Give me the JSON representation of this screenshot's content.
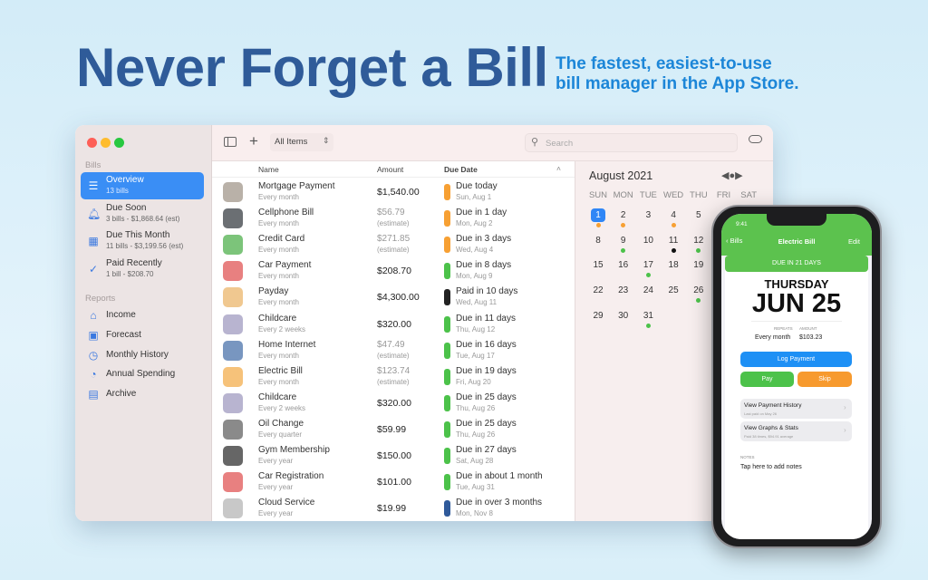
{
  "hero": {
    "headline": "Never Forget a Bill",
    "tagline_1": "The fastest, easiest-to-use",
    "tagline_2": "bill manager in the App Store."
  },
  "sidebar": {
    "bills_header": "Bills",
    "reports_header": "Reports",
    "items": [
      {
        "label": "Overview",
        "sub": "13 bills",
        "icon": "list-icon",
        "selected": true
      },
      {
        "label": "Due Soon",
        "sub": "3 bills - $1,868.64 (est)",
        "icon": "bell-icon"
      },
      {
        "label": "Due This Month",
        "sub": "11 bills - $3,199.56 (est)",
        "icon": "calendar-icon"
      },
      {
        "label": "Paid Recently",
        "sub": "1 bill - $208.70",
        "icon": "checkmark-icon"
      }
    ],
    "reports": [
      {
        "label": "Income",
        "icon": "bank-icon"
      },
      {
        "label": "Forecast",
        "icon": "chart-icon"
      },
      {
        "label": "Monthly History",
        "icon": "clock-icon"
      },
      {
        "label": "Annual Spending",
        "icon": "pie-icon"
      },
      {
        "label": "Archive",
        "icon": "archive-icon"
      }
    ]
  },
  "toolbar": {
    "filter": "All Items",
    "search_placeholder": "Search"
  },
  "table": {
    "columns": [
      "Name",
      "Amount",
      "Due Date"
    ],
    "rows": [
      {
        "name": "Mortgage Payment",
        "freq": "Every month",
        "amount": "$1,540.00",
        "due": "Due today",
        "date": "Sun, Aug 1",
        "status": "#f7a033",
        "icon": "house-icon",
        "icolor": "#b9b1a8"
      },
      {
        "name": "Cellphone Bill",
        "freq": "Every month",
        "amount": "$56.79",
        "estimate": "(estimate)",
        "due": "Due in 1 day",
        "date": "Mon, Aug 2",
        "status": "#f7a033",
        "icon": "phone-icon",
        "icolor": "#6b6f73"
      },
      {
        "name": "Credit Card",
        "freq": "Every month",
        "amount": "$271.85",
        "estimate": "(estimate)",
        "due": "Due in 3 days",
        "date": "Wed, Aug 4",
        "status": "#f7a033",
        "icon": "credit-card-icon",
        "icolor": "#7cc47a"
      },
      {
        "name": "Car Payment",
        "freq": "Every month",
        "amount": "$208.70",
        "due": "Due in 8 days",
        "date": "Mon, Aug 9",
        "status": "#4cc24a",
        "icon": "car-icon",
        "icolor": "#e88080"
      },
      {
        "name": "Payday",
        "freq": "Every month",
        "amount": "$4,300.00",
        "due": "Paid in 10 days",
        "date": "Wed, Aug 11",
        "status": "#222222",
        "icon": "coins-icon",
        "icolor": "#f0c890"
      },
      {
        "name": "Childcare",
        "freq": "Every 2 weeks",
        "amount": "$320.00",
        "due": "Due in 11 days",
        "date": "Thu, Aug 12",
        "status": "#4cc24a",
        "icon": "stroller-icon",
        "icolor": "#b8b4d0"
      },
      {
        "name": "Home Internet",
        "freq": "Every month",
        "amount": "$47.49",
        "estimate": "(estimate)",
        "due": "Due in 16 days",
        "date": "Tue, Aug 17",
        "status": "#4cc24a",
        "icon": "globe-icon",
        "icolor": "#7896c0"
      },
      {
        "name": "Electric Bill",
        "freq": "Every month",
        "amount": "$123.74",
        "estimate": "(estimate)",
        "due": "Due in 19 days",
        "date": "Fri, Aug 20",
        "status": "#4cc24a",
        "icon": "lightbulb-icon",
        "icolor": "#f6c27a"
      },
      {
        "name": "Childcare",
        "freq": "Every 2 weeks",
        "amount": "$320.00",
        "due": "Due in 25 days",
        "date": "Thu, Aug 26",
        "status": "#4cc24a",
        "icon": "stroller-icon",
        "icolor": "#b8b4d0"
      },
      {
        "name": "Oil Change",
        "freq": "Every quarter",
        "amount": "$59.99",
        "due": "Due in 25 days",
        "date": "Thu, Aug 26",
        "status": "#4cc24a",
        "icon": "wrench-icon",
        "icolor": "#8a8a8a"
      },
      {
        "name": "Gym Membership",
        "freq": "Every year",
        "amount": "$150.00",
        "due": "Due in 27 days",
        "date": "Sat, Aug 28",
        "status": "#4cc24a",
        "icon": "dumbbell-icon",
        "icolor": "#666666"
      },
      {
        "name": "Car Registration",
        "freq": "Every year",
        "amount": "$101.00",
        "due": "Due in about 1 month",
        "date": "Tue, Aug 31",
        "status": "#4cc24a",
        "icon": "car-icon",
        "icolor": "#e88080"
      },
      {
        "name": "Cloud Service",
        "freq": "Every year",
        "amount": "$19.99",
        "due": "Due in over 3 months",
        "date": "Mon, Nov 8",
        "status": "#2f5a9a",
        "icon": "cloud-icon",
        "icolor": "#c8c8c8"
      }
    ]
  },
  "calendar": {
    "title": "August 2021",
    "weekdays": [
      "SUN",
      "MON",
      "TUE",
      "WED",
      "THU",
      "FRI",
      "SAT"
    ],
    "first_weekday": 0,
    "days": 31,
    "today": 1,
    "dots": {
      "1": "#f7a033",
      "2": "#f7a033",
      "4": "#f7a033",
      "9": "#4cc24a",
      "11": "#111111",
      "12": "#4cc24a",
      "17": "#4cc24a",
      "26": "#4cc24a",
      "31": "#4cc24a"
    }
  },
  "phone": {
    "time": "9:41",
    "back": "Bills",
    "title": "Electric Bill",
    "edit": "Edit",
    "banner": "DUE IN 21 DAYS",
    "weekday": "THURSDAY",
    "date": "JUN 25",
    "repeats_label": "REPEATS",
    "repeats": "Every month",
    "amount_label": "AMOUNT",
    "amount": "$103.23",
    "log": "Log Payment",
    "pay": "Pay",
    "skip": "Skip",
    "history": "View Payment History",
    "history_sub": "Last paid on May 26",
    "graphs": "View Graphs & Stats",
    "graphs_sub": "Paid 38 times, $94.91 average",
    "notes_label": "NOTES",
    "notes": "Tap here to add notes"
  },
  "colors": {
    "accent": "#3a8ef5",
    "green": "#4cc24a",
    "orange": "#f7a033"
  }
}
